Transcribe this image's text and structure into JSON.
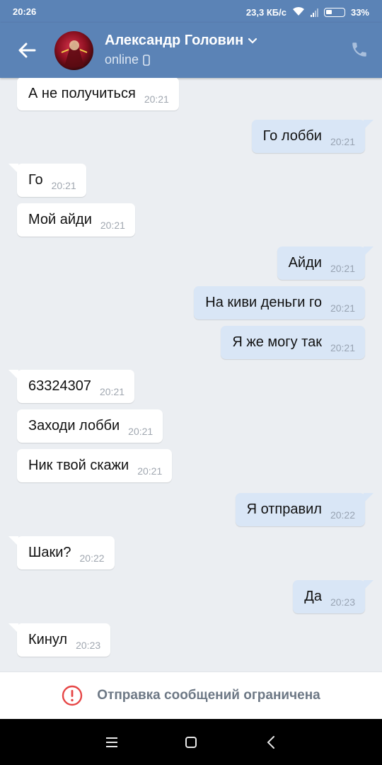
{
  "status_bar": {
    "time": "20:26",
    "speed": "23,3 КБ/с",
    "battery": "33%"
  },
  "header": {
    "contact_name": "Александр Головин",
    "status": "online"
  },
  "messages": [
    {
      "dir": "in",
      "text": "А не получиться",
      "time": "20:21",
      "tail": false
    },
    {
      "dir": "out",
      "text": "Го лобби",
      "time": "20:21",
      "tail": true
    },
    {
      "dir": "in",
      "text": "Го",
      "time": "20:21",
      "tail": true
    },
    {
      "dir": "in",
      "text": "Мой айди",
      "time": "20:21",
      "tail": false
    },
    {
      "dir": "out",
      "text": "Айди",
      "time": "20:21",
      "tail": true
    },
    {
      "dir": "out",
      "text": "На киви деньги го",
      "time": "20:21",
      "tail": false
    },
    {
      "dir": "out",
      "text": "Я же могу так",
      "time": "20:21",
      "tail": false
    },
    {
      "dir": "in",
      "text": "63324307",
      "time": "20:21",
      "tail": true
    },
    {
      "dir": "in",
      "text": "Заходи лобби",
      "time": "20:21",
      "tail": false
    },
    {
      "dir": "in",
      "text": "Ник твой скажи",
      "time": "20:21",
      "tail": false
    },
    {
      "dir": "out",
      "text": "Я отправил",
      "time": "20:22",
      "tail": true
    },
    {
      "dir": "in",
      "text": "Шаки?",
      "time": "20:22",
      "tail": true
    },
    {
      "dir": "out",
      "text": "Да",
      "time": "20:23",
      "tail": true
    },
    {
      "dir": "in",
      "text": "Кинул",
      "time": "20:23",
      "tail": true
    }
  ],
  "footer": {
    "restricted_text": "Отправка сообщений ограничена"
  },
  "colors": {
    "header": "#5b83b6",
    "incoming": "#ffffff",
    "outgoing": "#d9e6f6",
    "warning": "#e64646"
  }
}
